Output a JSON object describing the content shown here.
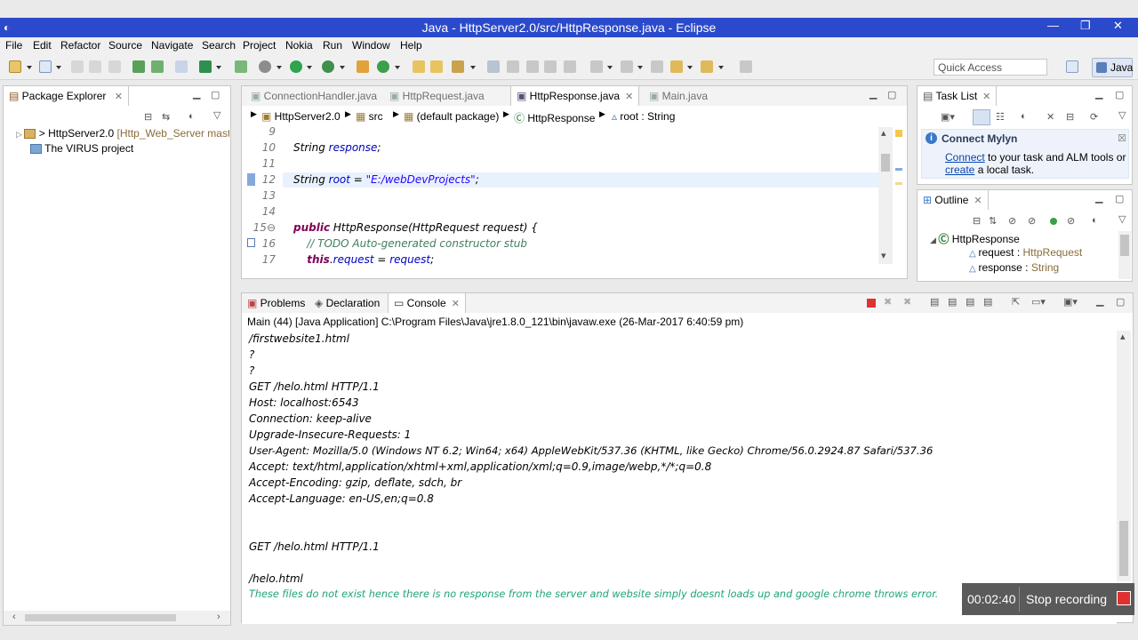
{
  "window": {
    "title": "Java - HttpServer2.0/src/HttpResponse.java - Eclipse",
    "controls": [
      "—",
      "❐",
      "✕"
    ]
  },
  "menu": [
    "File",
    "Edit",
    "Refactor",
    "Source",
    "Navigate",
    "Search",
    "Project",
    "Nokia",
    "Run",
    "Window",
    "Help"
  ],
  "toolbar": {
    "quick_access": "Quick Access",
    "perspective": "Java"
  },
  "package_explorer": {
    "tab": "Package Explorer",
    "items": [
      {
        "label": "> HttpServer2.0",
        "decoration": "[Http_Web_Server maste"
      },
      {
        "label": "The VIRUS project",
        "decoration": ""
      }
    ]
  },
  "editor": {
    "tabs": [
      "ConnectionHandler.java",
      "HttpRequest.java",
      "HttpResponse.java",
      "Main.java"
    ],
    "active_tab": "HttpResponse.java",
    "breadcrumb": [
      "HttpServer2.0",
      "src",
      "(default package)",
      "HttpResponse",
      "root : String"
    ],
    "lines": [
      {
        "n": "9",
        "code": ""
      },
      {
        "n": "10",
        "code": "String response;"
      },
      {
        "n": "11",
        "code": ""
      },
      {
        "n": "12",
        "code": "String root = \"E:/webDevProjects\";"
      },
      {
        "n": "13",
        "code": ""
      },
      {
        "n": "14",
        "code": ""
      },
      {
        "n": "15⊖",
        "code": "public HttpResponse(HttpRequest request) {"
      },
      {
        "n": "16",
        "code": "    // TODO Auto-generated constructor stub"
      },
      {
        "n": "17",
        "code": "    this.request = request;"
      }
    ]
  },
  "task_list": {
    "tab": "Task List",
    "mylyn_title": "Connect Mylyn",
    "mylyn_link1": "Connect",
    "mylyn_text1": " to your task and ALM tools or",
    "mylyn_link2": "create",
    "mylyn_text2": " a local task."
  },
  "outline": {
    "tab": "Outline",
    "class": "HttpResponse",
    "fields": [
      {
        "name": "request",
        "type": "HttpRequest"
      },
      {
        "name": "response",
        "type": "String"
      }
    ]
  },
  "console": {
    "tabs": [
      "Problems",
      "Declaration",
      "Console"
    ],
    "active_tab": "Console",
    "header": "Main (44) [Java Application] C:\\Program Files\\Java\\jre1.8.0_121\\bin\\javaw.exe (26-Mar-2017 6:40:59 pm)",
    "lines": [
      "/firstwebsite1.html",
      "?",
      "?",
      "GET /helo.html HTTP/1.1",
      "Host: localhost:6543",
      "Connection: keep-alive",
      "Upgrade-Insecure-Requests: 1",
      "User-Agent: Mozilla/5.0 (Windows NT 6.2; Win64; x64) AppleWebKit/537.36 (KHTML, like Gecko) Chrome/56.0.2924.87 Safari/537.36",
      "Accept: text/html,application/xhtml+xml,application/xml;q=0.9,image/webp,*/*;q=0.8",
      "Accept-Encoding: gzip, deflate, sdch, br",
      "Accept-Language: en-US,en;q=0.8",
      "",
      "",
      "GET /helo.html HTTP/1.1",
      "",
      "/helo.html"
    ],
    "input_line": "These files do not exist hence there is no response from the server and website simply doesnt loads up and google chrome throws error."
  },
  "recorder": {
    "time": "00:02:40",
    "stop_label": "Stop recording"
  }
}
